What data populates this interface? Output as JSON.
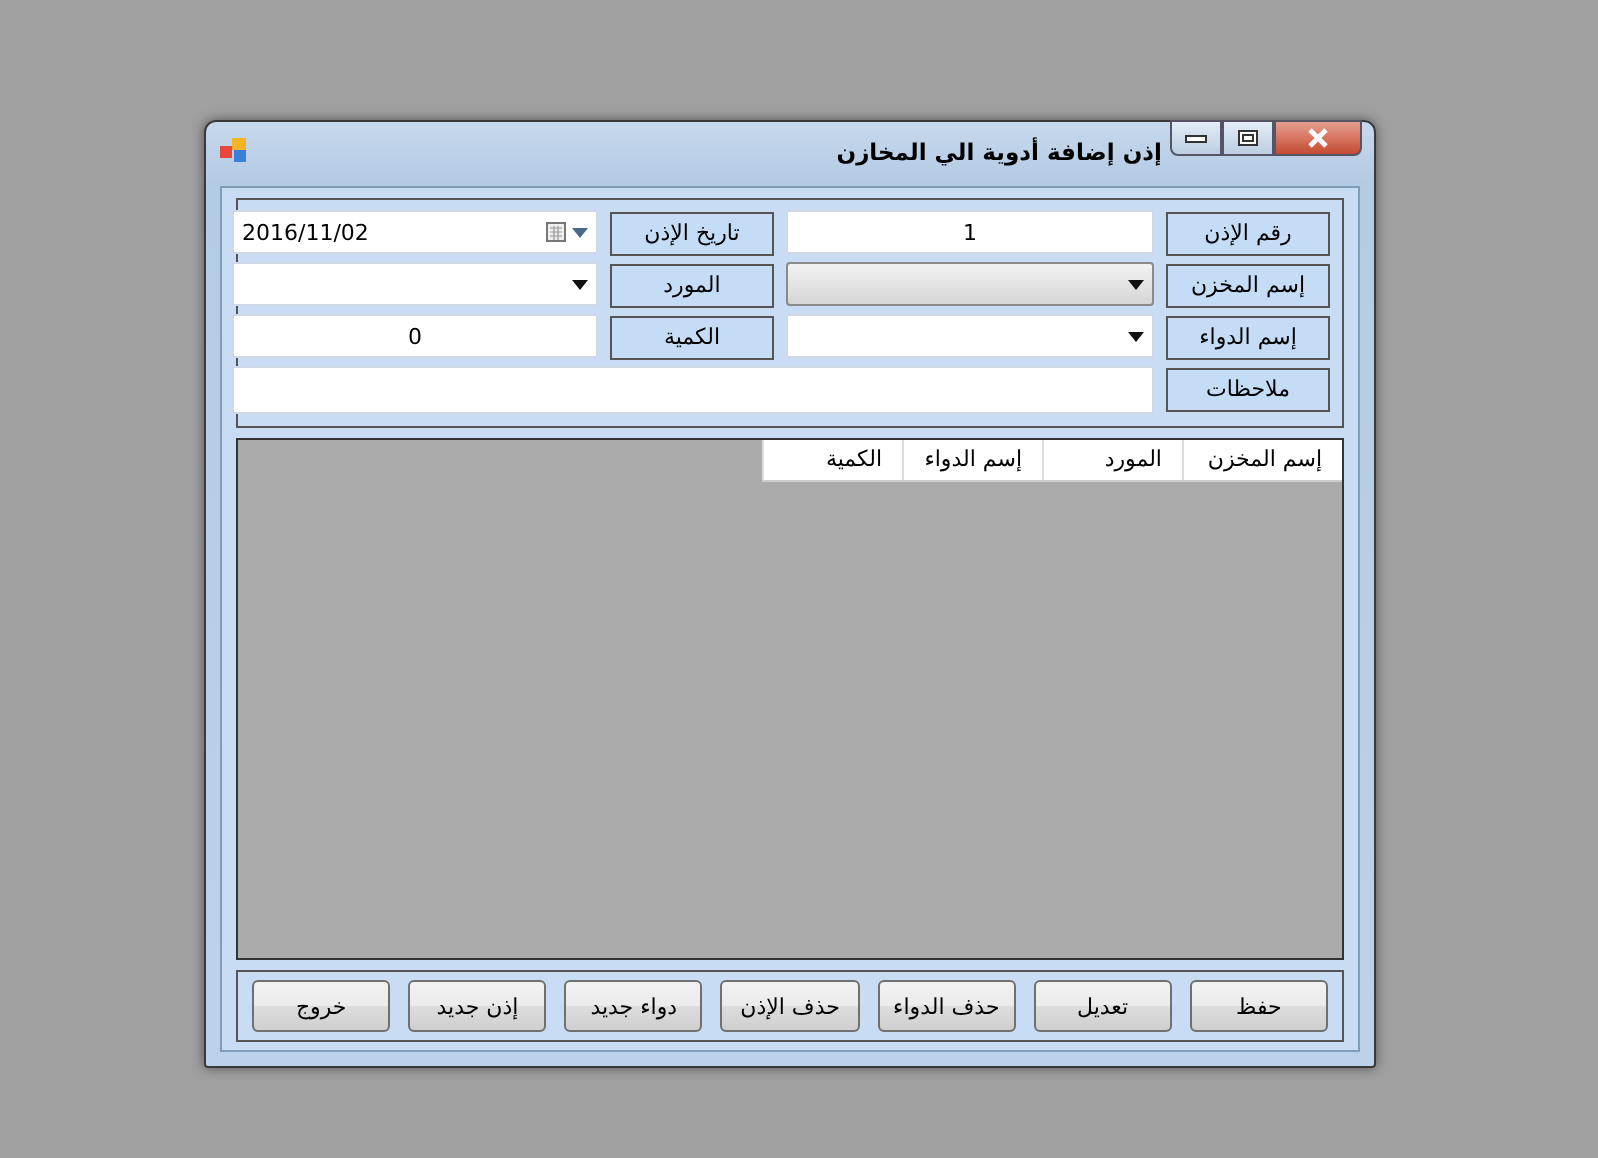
{
  "window": {
    "title": "إذن إضافة أدوية الي المخازن"
  },
  "fields": [
    {
      "label": "رقم الإذن",
      "kind": "text",
      "value": "1"
    },
    {
      "label": "تاريخ الإذن",
      "kind": "date",
      "value": "2016/11/02"
    },
    {
      "label": "إسم المخزن",
      "kind": "dropdown-list"
    },
    {
      "label": "المورد",
      "kind": "combo"
    },
    {
      "label": "إسم الدواء",
      "kind": "combo"
    },
    {
      "label": "الكمية",
      "kind": "text",
      "value": "0"
    },
    {
      "label": "ملاحظات",
      "kind": "notes"
    }
  ],
  "table": {
    "columns": [
      "إسم المخزن",
      "المورد",
      "إسم الدواء",
      "الكمية"
    ]
  },
  "buttons": [
    "حفظ",
    "تعديل",
    "حذف الدواء",
    "حذف الإذن",
    "دواء جديد",
    "إذن جديد",
    "خروج"
  ]
}
